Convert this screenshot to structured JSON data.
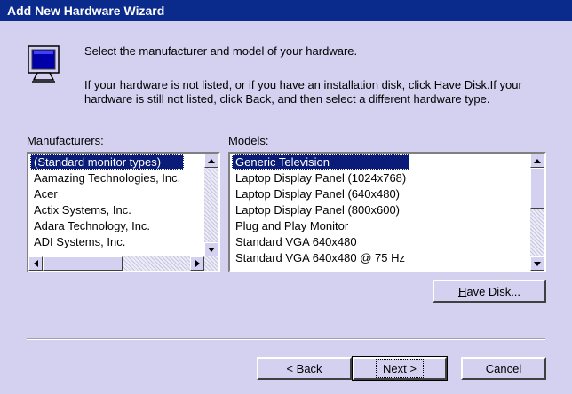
{
  "window": {
    "title": "Add New Hardware Wizard"
  },
  "intro": {
    "line1": "Select the manufacturer and model of your hardware.",
    "line2": "If your hardware is not listed, or if you have an installation disk, click Have Disk.If your hardware is still not listed, click Back, and then select a different hardware type.",
    "icon": "monitor-icon"
  },
  "manufacturers": {
    "label_underlined": "M",
    "label_rest": "anufacturers:",
    "items": [
      "(Standard monitor types)",
      "Aamazing Technologies, Inc.",
      "Acer",
      "Actix Systems, Inc.",
      "Adara Technology, Inc.",
      "ADI Systems, Inc."
    ],
    "selected_index": 0
  },
  "models": {
    "label_pre": "Mo",
    "label_underlined": "d",
    "label_rest": "els:",
    "items": [
      "Generic Television",
      "Laptop Display Panel (1024x768)",
      "Laptop Display Panel (640x480)",
      "Laptop Display Panel (800x600)",
      "Plug and Play Monitor",
      "Standard VGA 640x480",
      "Standard VGA 640x480 @ 75 Hz"
    ],
    "selected_index": 0
  },
  "buttons": {
    "have_disk_underlined": "H",
    "have_disk_rest": "ave Disk...",
    "back_pre": "< ",
    "back_underlined": "B",
    "back_rest": "ack",
    "next": "Next >",
    "cancel": "Cancel"
  },
  "colors": {
    "titlebar": "#0a2a8c",
    "background": "#d4d0f0",
    "selection": "#0a1c78"
  }
}
